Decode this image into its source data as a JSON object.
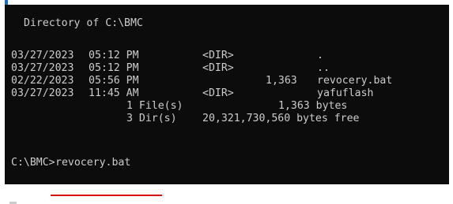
{
  "console": {
    "header": "Directory of C:\\BMC",
    "entries": [
      {
        "date": "03/27/2023",
        "time": "05:12 PM",
        "type": "<DIR>",
        "size": "",
        "name": "."
      },
      {
        "date": "03/27/2023",
        "time": "05:12 PM",
        "type": "<DIR>",
        "size": "",
        "name": ".."
      },
      {
        "date": "02/22/2023",
        "time": "05:56 PM",
        "type": "",
        "size": "1,363",
        "name": "revocery.bat"
      },
      {
        "date": "03/27/2023",
        "time": "11:45 AM",
        "type": "<DIR>",
        "size": "",
        "name": "yafuflash"
      }
    ],
    "summary_files": {
      "count": "1 File(s)",
      "size": "1,363 bytes"
    },
    "summary_dirs": {
      "count": "3 Dir(s)",
      "size": "20,321,730,560 bytes free"
    },
    "prompt": {
      "path": "C:\\BMC>",
      "command": "revocery.bat"
    },
    "colors": {
      "background": "#0c0c0c",
      "text": "#cccccc",
      "window_edge": "#1a6fc4",
      "command_underline": "#d51212"
    }
  }
}
